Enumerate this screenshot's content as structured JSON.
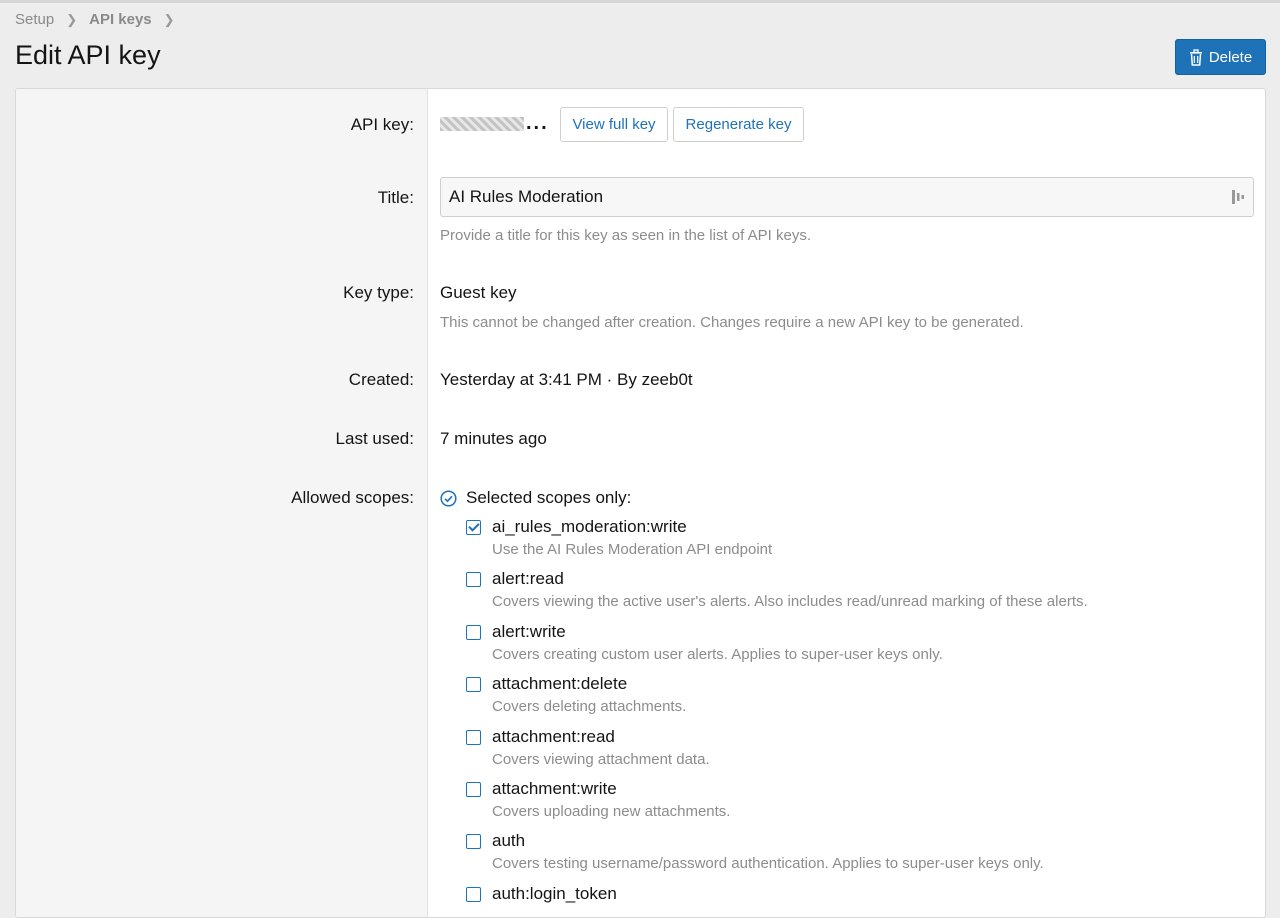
{
  "breadcrumb": {
    "items": [
      "Setup",
      "API keys"
    ]
  },
  "page": {
    "title": "Edit API key",
    "delete_label": "Delete"
  },
  "fields": {
    "api_key": {
      "label": "API key:",
      "masked_suffix": "...",
      "view_label": "View full key",
      "regen_label": "Regenerate key"
    },
    "title": {
      "label": "Title:",
      "value": "AI Rules Moderation",
      "hint": "Provide a title for this key as seen in the list of API keys."
    },
    "key_type": {
      "label": "Key type:",
      "value": "Guest key",
      "hint": "This cannot be changed after creation. Changes require a new API key to be generated."
    },
    "created": {
      "label": "Created:",
      "value": "Yesterday at 3:41 PM · By zeeb0t"
    },
    "last_used": {
      "label": "Last used:",
      "value": "7 minutes ago"
    },
    "scopes": {
      "label": "Allowed scopes:",
      "mode": "Selected scopes only:",
      "items": [
        {
          "name": "ai_rules_moderation:write",
          "desc": "Use the AI Rules Moderation API endpoint",
          "checked": true
        },
        {
          "name": "alert:read",
          "desc": "Covers viewing the active user's alerts. Also includes read/unread marking of these alerts.",
          "checked": false
        },
        {
          "name": "alert:write",
          "desc": "Covers creating custom user alerts. Applies to super-user keys only.",
          "checked": false
        },
        {
          "name": "attachment:delete",
          "desc": "Covers deleting attachments.",
          "checked": false
        },
        {
          "name": "attachment:read",
          "desc": "Covers viewing attachment data.",
          "checked": false
        },
        {
          "name": "attachment:write",
          "desc": "Covers uploading new attachments.",
          "checked": false
        },
        {
          "name": "auth",
          "desc": "Covers testing username/password authentication. Applies to super-user keys only.",
          "checked": false
        },
        {
          "name": "auth:login_token",
          "desc": "",
          "checked": false
        }
      ]
    }
  },
  "colors": {
    "accent": "#1d72b8"
  }
}
